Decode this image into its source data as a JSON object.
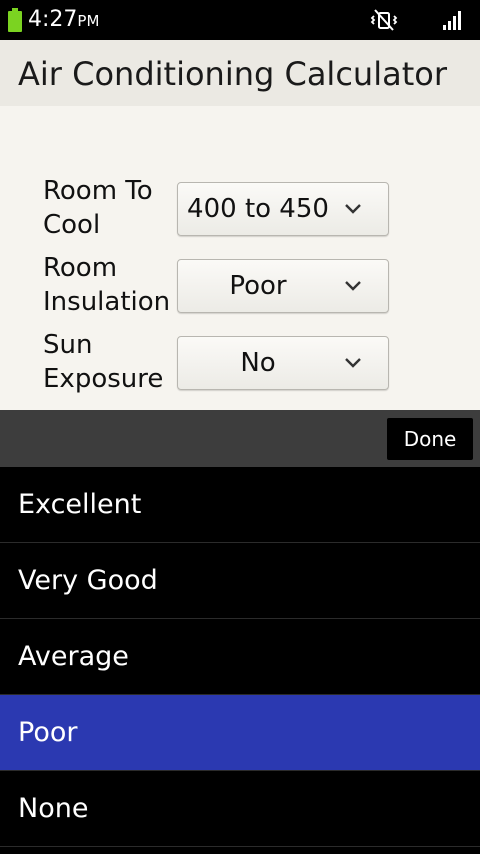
{
  "status_bar": {
    "time": "4:27",
    "ampm": "PM",
    "icons": [
      "battery-icon",
      "vibrate-icon",
      "signal-icon"
    ],
    "battery_color": "#7bd321"
  },
  "app": {
    "title": "Air Conditioning Calculator"
  },
  "form": {
    "fields": [
      {
        "label_line1": "Room To",
        "label_line2": "Cool",
        "value": "400 to 450"
      },
      {
        "label_line1": "Room",
        "label_line2": "Insulation",
        "value": "Poor"
      },
      {
        "label_line1": "Sun",
        "label_line2": "Exposure",
        "value": "No"
      }
    ]
  },
  "picker": {
    "done_label": "Done",
    "options": [
      "Excellent",
      "Very Good",
      "Average",
      "Poor",
      "None"
    ],
    "selected": "Poor",
    "selected_color": "#2b39b1"
  }
}
